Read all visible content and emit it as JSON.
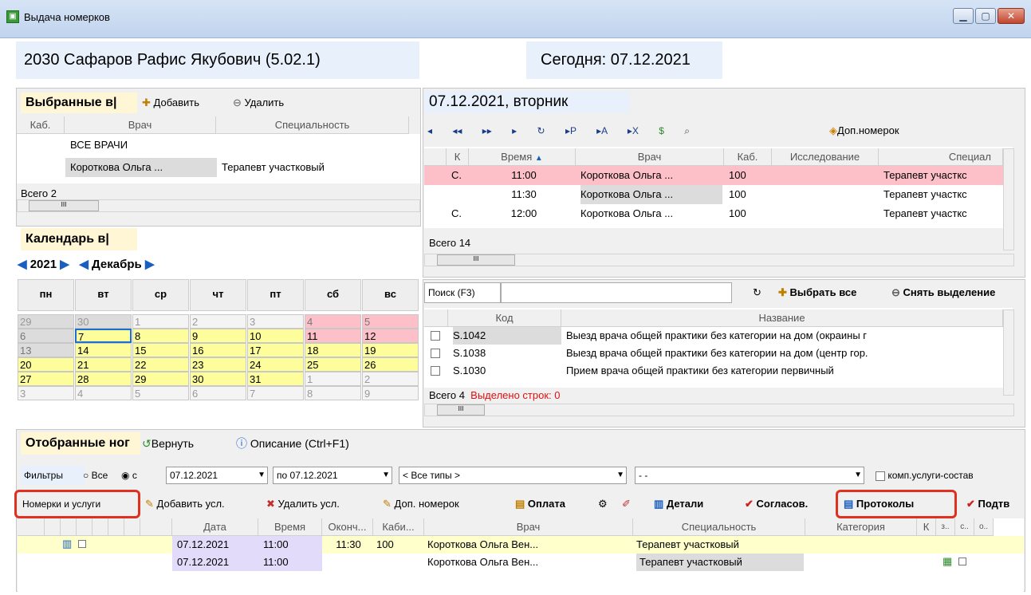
{
  "window": {
    "title": "Выдача номерков"
  },
  "patient": {
    "name": "2030 Сафаров Рафис Якубович (5.02.1)",
    "today": "Сегодня: 07.12.2021"
  },
  "doctors": {
    "header": "Выбранные в|",
    "add": "Добавить",
    "remove": "Удалить",
    "cols": [
      "Каб.",
      "Врач",
      "Специальность"
    ],
    "rows": [
      [
        "",
        "ВСЕ ВРАЧИ",
        ""
      ],
      [
        "",
        "Короткова Ольга ...",
        "Терапевт участковый"
      ]
    ],
    "total": "Всего 2"
  },
  "calendar": {
    "header": "Календарь в|",
    "year": "2021",
    "month": "Декабрь",
    "days": [
      "пн",
      "вт",
      "ср",
      "чт",
      "пт",
      "сб",
      "вс"
    ],
    "weeks": [
      [
        "29",
        "30",
        "1",
        "2",
        "3",
        "4",
        "5"
      ],
      [
        "6",
        "7",
        "8",
        "9",
        "10",
        "11",
        "12"
      ],
      [
        "13",
        "14",
        "15",
        "16",
        "17",
        "18",
        "19"
      ],
      [
        "20",
        "21",
        "22",
        "23",
        "24",
        "25",
        "26"
      ],
      [
        "27",
        "28",
        "29",
        "30",
        "31",
        "1",
        "2"
      ],
      [
        "3",
        "4",
        "5",
        "6",
        "7",
        "8",
        "9"
      ]
    ]
  },
  "schedule": {
    "date": "07.12.2021, вторник",
    "extra": "Доп.номерок",
    "cols": [
      "К",
      "Время",
      "Врач",
      "Каб.",
      "Исследование",
      "Специал"
    ],
    "rows": [
      [
        "С.",
        "11:00",
        "Короткова Ольга ...",
        "100",
        "",
        "Терапевт участкс"
      ],
      [
        "",
        "11:30",
        "Короткова Ольга ...",
        "100",
        "",
        "Терапевт участкс"
      ],
      [
        "С.",
        "12:00",
        "Короткова Ольга ...",
        "100",
        "",
        "Терапевт участкс"
      ]
    ],
    "total": "Всего 14"
  },
  "services": {
    "search": "Поиск (F3)",
    "selectAll": "Выбрать все",
    "deselect": "Снять выделение",
    "cols": [
      "Код",
      "Название"
    ],
    "rows": [
      [
        "S.1042",
        "Выезд врача общей практики без категории на дом (окраины г"
      ],
      [
        "S.1038",
        "Выезд врача общей практики без категории на дом (центр гор."
      ],
      [
        "S.1030",
        "Прием врача общей практики без категории первичный"
      ]
    ],
    "total": "Всего 4",
    "selected": "Выделено строк: 0"
  },
  "selected": {
    "header": "Отобранные ног",
    "back": "Вернуть",
    "desc": "Описание (Ctrl+F1)",
    "filters": "Фильтры",
    "all": "Все",
    "from": "с",
    "dateFrom": "07.12.2021",
    "to": "по",
    "dateTo": "07.12.2021",
    "types": "< Все типы >",
    "dash": "- -",
    "comp": "комп.услуги-состав",
    "tab": "Номерки и услуги",
    "addSvc": "Добавить усл.",
    "delSvc": "Удалить усл.",
    "extraNum": "Доп. номерок",
    "pay": "Оплата",
    "details": "Детали",
    "agree": "Согласов.",
    "protocols": "Протоколы",
    "confirm": "Подтв",
    "cols": [
      "Дата",
      "Время",
      "Оконч...",
      "Каби...",
      "Врач",
      "Специальность",
      "Категория",
      "К",
      "з..",
      "с..",
      "о.."
    ],
    "rows": [
      [
        "07.12.2021",
        "11:00",
        "11:30",
        "100",
        "Короткова Ольга Вен...",
        "Терапевт участковый",
        ""
      ],
      [
        "07.12.2021",
        "11:00",
        "",
        "",
        "Короткова Ольга Вен...",
        "Терапевт участковый",
        ""
      ]
    ]
  },
  "colors": {
    "pink": "#fdc0c8",
    "yellow": "#fdfd9c",
    "lavender": "#e2dcfa"
  }
}
